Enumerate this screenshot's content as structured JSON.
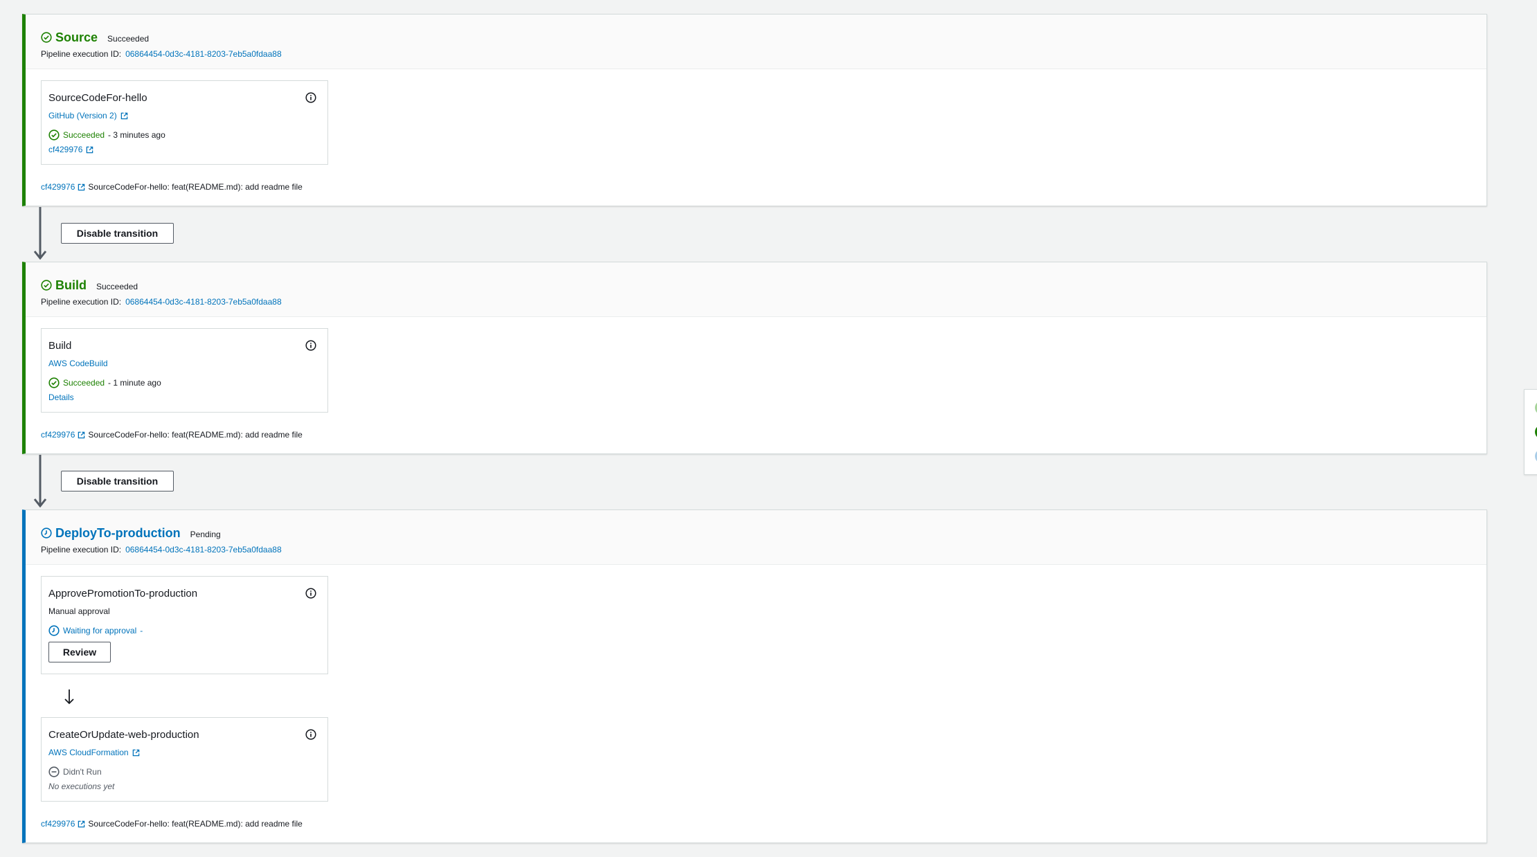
{
  "colors": {
    "success": "#1d8102",
    "pending": "#0073bb",
    "link": "#0073bb",
    "background": "#f2f3f3"
  },
  "stages": [
    {
      "name": "Source",
      "status": "Succeeded",
      "state": "succeeded",
      "exec_label": "Pipeline execution ID:",
      "exec_id": "06864454-0d3c-4181-8203-7eb5a0fdaa88",
      "actions": [
        {
          "name": "SourceCodeFor-hello",
          "provider": "GitHub (Version 2)",
          "status": "Succeeded",
          "time": "- 3 minutes ago",
          "sub_link": "cf429976"
        }
      ],
      "commit_id": "cf429976",
      "commit_message": "SourceCodeFor-hello: feat(README.md): add readme file"
    },
    {
      "name": "Build",
      "status": "Succeeded",
      "state": "succeeded",
      "exec_label": "Pipeline execution ID:",
      "exec_id": "06864454-0d3c-4181-8203-7eb5a0fdaa88",
      "actions": [
        {
          "name": "Build",
          "provider": "AWS CodeBuild",
          "status": "Succeeded",
          "time": "- 1 minute ago",
          "sub_link": "Details"
        }
      ],
      "commit_id": "cf429976",
      "commit_message": "SourceCodeFor-hello: feat(README.md): add readme file"
    },
    {
      "name": "DeployTo-production",
      "status": "Pending",
      "state": "pending",
      "exec_label": "Pipeline execution ID:",
      "exec_id": "06864454-0d3c-4181-8203-7eb5a0fdaa88",
      "actions": [
        {
          "name": "ApprovePromotionTo-production",
          "provider": "Manual approval",
          "status": "Waiting for approval",
          "time": "-",
          "button": "Review"
        },
        {
          "name": "CreateOrUpdate-web-production",
          "provider": "AWS CloudFormation",
          "status": "Didn't Run",
          "sub_text": "No executions yet"
        }
      ],
      "commit_id": "cf429976",
      "commit_message": "SourceCodeFor-hello: feat(README.md): add readme file"
    }
  ],
  "transitions": [
    {
      "button_label": "Disable transition"
    },
    {
      "button_label": "Disable transition"
    }
  ],
  "icons": {
    "status_ok": "check-circle-icon",
    "status_wait": "clock-icon",
    "status_none": "minus-circle-icon",
    "info": "info-icon",
    "external": "external-link-icon"
  }
}
